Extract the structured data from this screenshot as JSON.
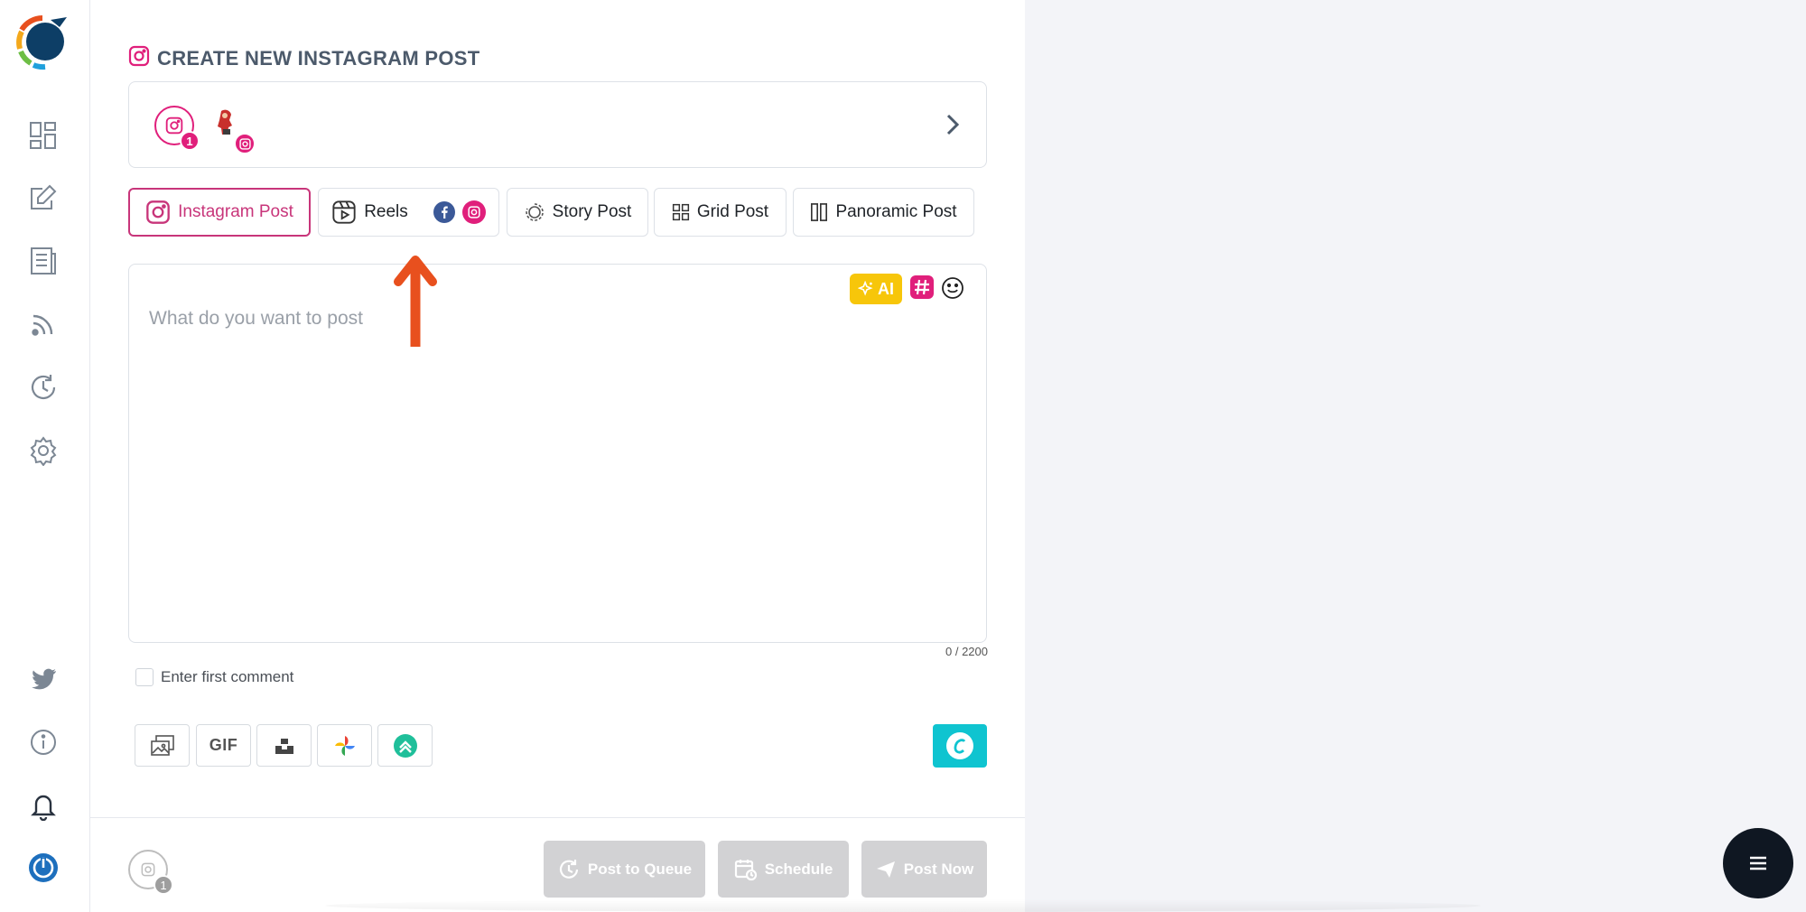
{
  "header": {
    "title": "CREATE NEW INSTAGRAM POST"
  },
  "accounts": {
    "selected_count": "1"
  },
  "tabs": [
    {
      "label": "Instagram Post"
    },
    {
      "label": "Reels"
    },
    {
      "label": "Story Post"
    },
    {
      "label": "Grid Post"
    },
    {
      "label": "Panoramic Post"
    }
  ],
  "editor": {
    "placeholder": "What do you want to post",
    "ai_label": "AI",
    "counter": "0 / 2200"
  },
  "first_comment": {
    "label": "Enter first comment"
  },
  "media": {
    "gif_label": "GIF"
  },
  "footer": {
    "account_count": "1",
    "post_to_queue": "Post to Queue",
    "schedule": "Schedule",
    "post_now": "Post Now"
  },
  "colors": {
    "instagram": "#e01f7b",
    "active_tab": "#c8357a",
    "ai": "#f7c60a",
    "canva": "#0fc4d0",
    "disabled_button": "#d2d2d4",
    "annotation_arrow": "#e8501e"
  },
  "icons": {
    "sidebar": [
      "dashboard-icon",
      "compose-icon",
      "articles-icon",
      "rss-icon",
      "history-icon",
      "settings-icon",
      "twitter-icon",
      "info-icon",
      "bell-icon",
      "power-icon"
    ]
  }
}
